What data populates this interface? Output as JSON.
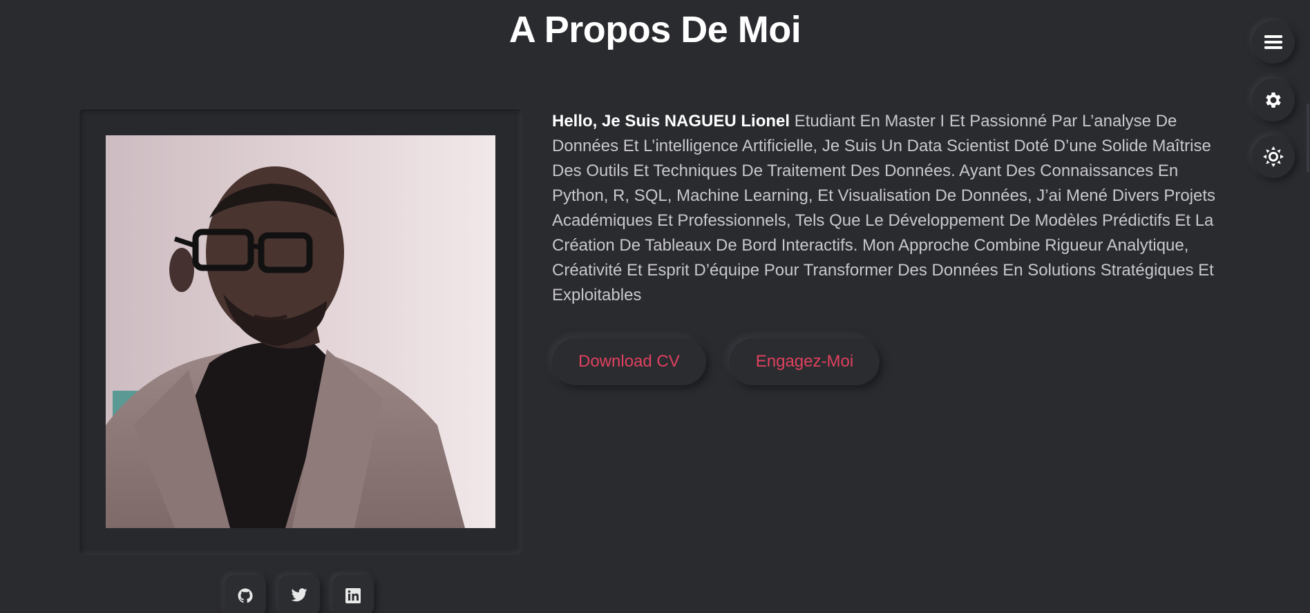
{
  "section": {
    "title": "A Propos De Moi"
  },
  "about": {
    "intro": "Hello, Je Suis NAGUEU Lionel",
    "description": "Etudiant En Master I Et Passionné Par L’analyse De Données Et L’intelligence Artificielle, Je Suis Un Data Scientist Doté D’une Solide Maîtrise Des Outils Et Techniques De Traitement Des Données. Ayant Des Connaissances En Python, R, SQL, Machine Learning, Et Visualisation De Données, J’ai Mené Divers Projets Académiques Et Professionnels, Tels Que Le Développement De Modèles Prédictifs Et La Création De Tableaux De Bord Interactifs. Mon Approche Combine Rigueur Analytique, Créativité Et Esprit D’équipe Pour Transformer Des Données En Solutions Stratégiques Et Exploitables"
  },
  "actions": {
    "download_cv": "Download CV",
    "hire_me": "Engagez-Moi"
  },
  "socials": [
    "github-icon",
    "twitter-icon",
    "linkedin-icon"
  ],
  "side_controls": [
    "menu-icon",
    "gear-icon",
    "sun-icon"
  ],
  "colors": {
    "background": "#2a2b2f",
    "accent": "#e0415f",
    "title": "#ffffff",
    "body_text": "#c9c9cc"
  }
}
